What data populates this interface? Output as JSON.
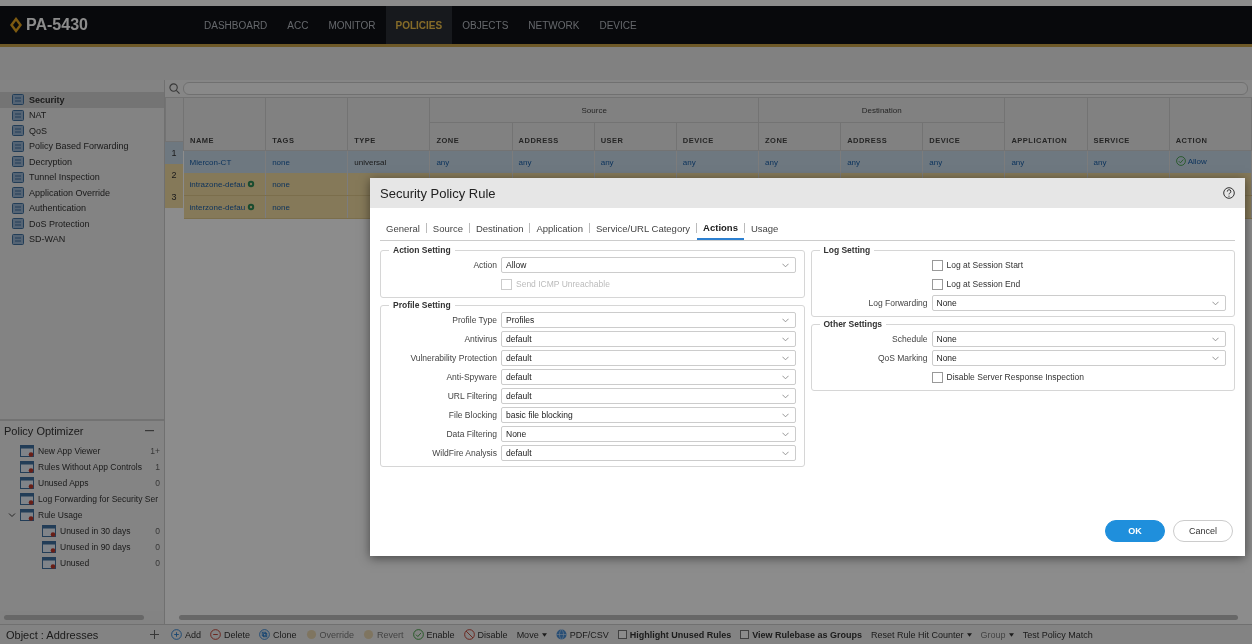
{
  "app": {
    "logo": "PA-5430"
  },
  "nav": [
    {
      "label": "DASHBOARD",
      "selected": false
    },
    {
      "label": "ACC",
      "selected": false
    },
    {
      "label": "MONITOR",
      "selected": false
    },
    {
      "label": "POLICIES",
      "selected": true
    },
    {
      "label": "OBJECTS",
      "selected": false
    },
    {
      "label": "NETWORK",
      "selected": false
    },
    {
      "label": "DEVICE",
      "selected": false
    }
  ],
  "sidebar": {
    "items": [
      {
        "label": "Security",
        "selected": true
      },
      {
        "label": "NAT",
        "selected": false
      },
      {
        "label": "QoS",
        "selected": false
      },
      {
        "label": "Policy Based Forwarding",
        "selected": false
      },
      {
        "label": "Decryption",
        "selected": false
      },
      {
        "label": "Tunnel Inspection",
        "selected": false
      },
      {
        "label": "Application Override",
        "selected": false
      },
      {
        "label": "Authentication",
        "selected": false
      },
      {
        "label": "DoS Protection",
        "selected": false
      },
      {
        "label": "SD-WAN",
        "selected": false
      }
    ]
  },
  "policy_optimizer": {
    "title": "Policy Optimizer",
    "items": [
      {
        "label": "New App Viewer",
        "count": "1+"
      },
      {
        "label": "Rules Without App Controls",
        "count": "1"
      },
      {
        "label": "Unused Apps",
        "count": "0"
      },
      {
        "label": "Log Forwarding for Security Ser"
      },
      {
        "label": "Rule Usage",
        "expanded": true,
        "children": [
          {
            "label": "Unused in 30 days",
            "count": "0"
          },
          {
            "label": "Unused in 90 days",
            "count": "0"
          },
          {
            "label": "Unused",
            "count": "0"
          }
        ]
      }
    ]
  },
  "object_panel": {
    "title": "Object : Addresses"
  },
  "table": {
    "columns": [
      {
        "label": "NAME"
      },
      {
        "label": "TAGS"
      },
      {
        "label": "TYPE"
      },
      {
        "label": "Source",
        "colspan": 4,
        "children": [
          {
            "label": "ZONE"
          },
          {
            "label": "ADDRESS"
          },
          {
            "label": "USER"
          },
          {
            "label": "DEVICE"
          }
        ]
      },
      {
        "label": "Destination",
        "colspan": 3,
        "children": [
          {
            "label": "ZONE"
          },
          {
            "label": "ADDRESS"
          },
          {
            "label": "DEVICE"
          }
        ]
      },
      {
        "label": "APPLICATION"
      },
      {
        "label": "SERVICE"
      },
      {
        "label": "ACTION"
      }
    ],
    "rows": [
      {
        "num": "1",
        "kind": "custom",
        "selected": true,
        "cells": [
          "Miercon-CT",
          "none",
          "universal",
          "any",
          "any",
          "any",
          "any",
          "any",
          "any",
          "any",
          "any",
          "any",
          "Allow"
        ]
      },
      {
        "num": "2",
        "kind": "default",
        "selected": false,
        "cells": [
          "intrazone-defau",
          "none"
        ]
      },
      {
        "num": "3",
        "kind": "default",
        "selected": false,
        "cells": [
          "interzone-defau",
          "none"
        ]
      }
    ]
  },
  "toolbar": [
    {
      "label": "Add",
      "kind": "add",
      "disabled": false
    },
    {
      "label": "Delete",
      "kind": "delete",
      "disabled": false
    },
    {
      "label": "Clone",
      "kind": "clone",
      "disabled": false
    },
    {
      "label": "Override",
      "kind": "override",
      "disabled": true
    },
    {
      "label": "Revert",
      "kind": "revert",
      "disabled": true
    },
    {
      "label": "Enable",
      "kind": "enable",
      "disabled": false
    },
    {
      "label": "Disable",
      "kind": "disable",
      "disabled": false
    },
    {
      "label": "Move",
      "kind": "menu",
      "disabled": false
    },
    {
      "label": "PDF/CSV",
      "kind": "pdf",
      "disabled": false
    },
    {
      "label": "Highlight Unused Rules",
      "kind": "checkbox",
      "checked": false,
      "disabled": false
    },
    {
      "label": "View Rulebase as Groups",
      "kind": "checkbox",
      "checked": false,
      "disabled": false
    },
    {
      "label": "Reset Rule Hit Counter",
      "kind": "menu",
      "disabled": false
    },
    {
      "label": "Group",
      "kind": "menu",
      "disabled": true
    },
    {
      "label": "Test Policy Match",
      "kind": "plain",
      "disabled": false
    }
  ],
  "modal": {
    "title": "Security Policy Rule",
    "tabs": [
      {
        "label": "General",
        "selected": false
      },
      {
        "label": "Source",
        "selected": false
      },
      {
        "label": "Destination",
        "selected": false
      },
      {
        "label": "Application",
        "selected": false
      },
      {
        "label": "Service/URL Category",
        "selected": false
      },
      {
        "label": "Actions",
        "selected": true
      },
      {
        "label": "Usage",
        "selected": false
      }
    ],
    "left": [
      {
        "title": "Action Setting",
        "fields": [
          {
            "kind": "select",
            "label": "Action",
            "value": "Allow"
          },
          {
            "kind": "checkbox",
            "label": "Send ICMP Unreachable",
            "checked": false,
            "disabled": true
          }
        ]
      },
      {
        "title": "Profile Setting",
        "fields": [
          {
            "kind": "select",
            "label": "Profile Type",
            "value": "Profiles"
          },
          {
            "kind": "select",
            "label": "Antivirus",
            "value": "default"
          },
          {
            "kind": "select",
            "label": "Vulnerability Protection",
            "value": "default"
          },
          {
            "kind": "select",
            "label": "Anti-Spyware",
            "value": "default"
          },
          {
            "kind": "select",
            "label": "URL Filtering",
            "value": "default"
          },
          {
            "kind": "select",
            "label": "File Blocking",
            "value": "basic file blocking"
          },
          {
            "kind": "select",
            "label": "Data Filtering",
            "value": "None"
          },
          {
            "kind": "select",
            "label": "WildFire Analysis",
            "value": "default"
          }
        ]
      }
    ],
    "right": [
      {
        "title": "Log Setting",
        "fields": [
          {
            "kind": "checkbox",
            "label": "Log at Session Start",
            "checked": false,
            "disabled": false
          },
          {
            "kind": "checkbox",
            "label": "Log at Session End",
            "checked": false,
            "disabled": false
          },
          {
            "kind": "select",
            "label": "Log Forwarding",
            "value": "None"
          }
        ]
      },
      {
        "title": "Other Settings",
        "fields": [
          {
            "kind": "select",
            "label": "Schedule",
            "value": "None"
          },
          {
            "kind": "select",
            "label": "QoS Marking",
            "value": "None"
          },
          {
            "kind": "checkbox",
            "label": "Disable Server Response Inspection",
            "checked": false,
            "disabled": false
          }
        ]
      }
    ],
    "buttons": [
      {
        "label": "OK",
        "kind": "primary"
      },
      {
        "label": "Cancel",
        "kind": "secondary"
      }
    ]
  }
}
